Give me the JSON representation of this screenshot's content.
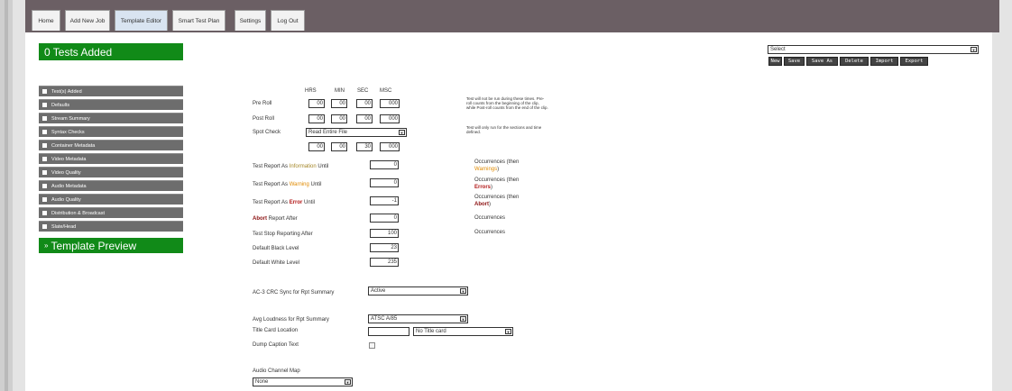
{
  "nav": {
    "tabs": [
      {
        "label": "Home"
      },
      {
        "label": "Add New Job"
      },
      {
        "label": "Template Editor"
      },
      {
        "label": "Smart Test Plan"
      },
      {
        "label": "Settings"
      },
      {
        "label": "Log Out"
      }
    ],
    "active_tab": "Template Editor"
  },
  "header": {
    "tests_added": "0 Tests Added",
    "select_value": "Select",
    "buttons": [
      "New",
      "Save",
      "Save As",
      "Delete",
      "Import",
      "Export"
    ]
  },
  "sidebar": {
    "items": [
      {
        "label": "Test(s) Added"
      },
      {
        "label": "Defaults"
      },
      {
        "label": "Stream Summary"
      },
      {
        "label": "Syntax Checks"
      },
      {
        "label": "Container Metadata"
      },
      {
        "label": "Video Metadata"
      },
      {
        "label": "Video Quality"
      },
      {
        "label": "Audio Metadata"
      },
      {
        "label": "Audio Quality"
      },
      {
        "label": "Distribution & Broadcast"
      },
      {
        "label": "Slate/Head"
      }
    ],
    "template_preview": "Template Preview",
    "template_preview_icon": "»"
  },
  "timing": {
    "headers": {
      "hrs": "HRS",
      "min": "MIN",
      "sec": "SEC",
      "msc": "MSC"
    },
    "pre_roll": {
      "label": "Pre Roll",
      "values": [
        "00",
        "00",
        "00",
        "000"
      ]
    },
    "post_roll": {
      "label": "Post Roll",
      "values": [
        "00",
        "00",
        "00",
        "000"
      ]
    },
    "spot_check": {
      "label": "Spot Check",
      "mode": "Read Entire File",
      "values": [
        "00",
        "00",
        "30",
        "000"
      ]
    },
    "note1": "Test will not be run during these times. Pre-roll counts from the beginning of the clip, while Post-roll counts from the end of the clip.",
    "note2": "Test will only run for the sections and time defined."
  },
  "report": {
    "info_until": {
      "prefix": "Test Report As ",
      "word": "Information",
      "suffix": " Until",
      "value": "0"
    },
    "warning_until": {
      "prefix": "Test Report As ",
      "word": "Warning",
      "suffix": " Until",
      "value": "0"
    },
    "error_until": {
      "prefix": "Test Report As ",
      "word": "Error",
      "suffix": " Until",
      "value": "-1"
    },
    "abort_after": {
      "word": "Abort",
      "suffix": " Report After",
      "value": "0"
    },
    "stop_reporting": {
      "label": "Test Stop Reporting After",
      "value": "100"
    },
    "black_level": {
      "label": "Default Black Level",
      "value": "23"
    },
    "white_level": {
      "label": "Default White Level",
      "value": "235"
    },
    "occ_info": {
      "prefix": "Occurrences (then",
      "word": "Warnings",
      "suffix": ")"
    },
    "occ_warning": {
      "prefix": "Occurrences (then",
      "word": "Errors",
      "suffix": ")"
    },
    "occ_error": {
      "prefix": "Occurrences (then",
      "word": "Abort",
      "suffix": ")"
    },
    "occ_abort": "Occurrences",
    "occ_stop": "Occurrences"
  },
  "options": {
    "ac3_crc": {
      "label": "AC-3 CRC Sync for Rpt Summary",
      "value": "Active"
    },
    "avg_loudness": {
      "label": "Avg Loudness for Rpt Summary",
      "value": "ATSC A/85"
    },
    "title_card": {
      "label": "Title Card Location",
      "value": "",
      "select": "No Title card"
    },
    "dump_caption": {
      "label": "Dump Caption Text"
    },
    "audio_channel_map": {
      "label": "Audio Channel Map",
      "value": "None"
    }
  },
  "colors": {
    "green": "#118a18",
    "topbar": "#6b5f64",
    "sidebar": "#6d6d6d",
    "warning": "#e08a00",
    "error": "#b21818"
  }
}
